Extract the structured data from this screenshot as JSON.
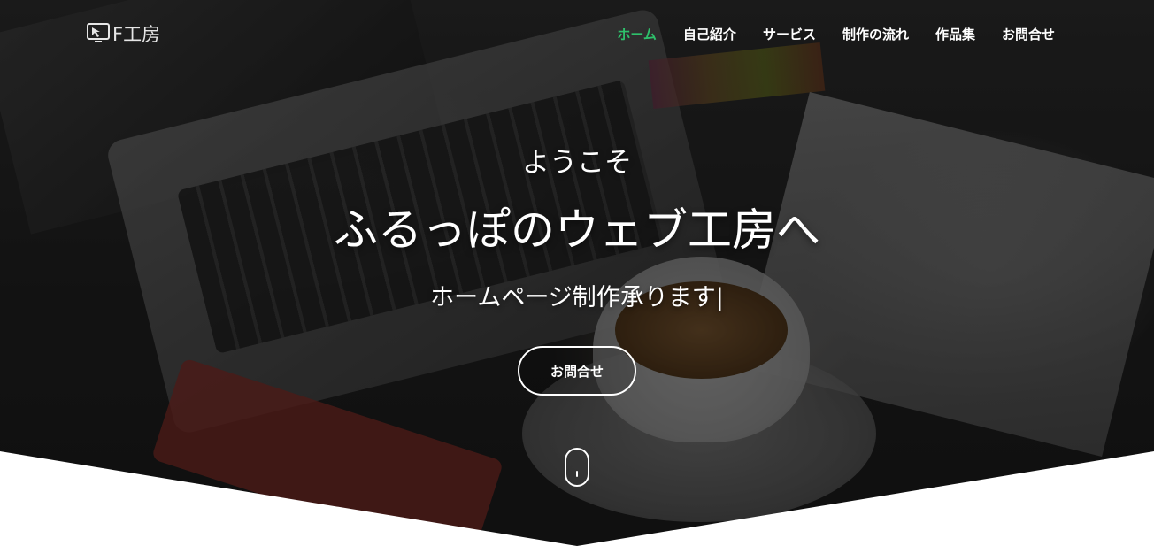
{
  "brand": {
    "logo_text": "F工房",
    "logo_icon": "monitor-cursor-icon"
  },
  "nav": {
    "items": [
      {
        "label": "ホーム",
        "active": true
      },
      {
        "label": "自己紹介",
        "active": false
      },
      {
        "label": "サービス",
        "active": false
      },
      {
        "label": "制作の流れ",
        "active": false
      },
      {
        "label": "作品集",
        "active": false
      },
      {
        "label": "お問合せ",
        "active": false
      }
    ],
    "active_color": "#2ec06b"
  },
  "hero": {
    "welcome": "ようこそ",
    "headline": "ふるっぽのウェブ工房へ",
    "tagline": "ホームページ制作承ります|",
    "cta_label": "お問合せ",
    "scroll_icon": "mouse-scroll-icon"
  }
}
